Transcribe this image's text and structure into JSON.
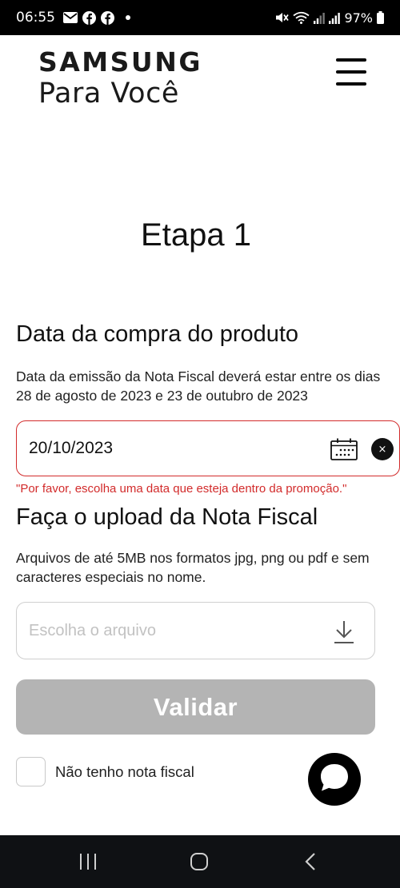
{
  "status_bar": {
    "time": "06:55",
    "battery": "97%",
    "icons": [
      "mail-icon",
      "facebook-icon",
      "facebook-icon",
      "dot-icon",
      "mute-icon",
      "wifi-icon",
      "signal-icon",
      "signal-icon",
      "battery-icon"
    ]
  },
  "header": {
    "brand": "SAMSUNG",
    "subtitle": "Para Você"
  },
  "step": {
    "title": "Etapa 1"
  },
  "purchase_date": {
    "title": "Data da compra do produto",
    "description": "Data da emissão da Nota Fiscal deverá estar entre os dias 28 de agosto de 2023 e 23 de outubro de 2023",
    "value": "20/10/2023",
    "clear_label": "×",
    "error": "\"Por favor, escolha uma data que esteja dentro da promoção.\""
  },
  "upload": {
    "title": "Faça o upload da Nota Fiscal",
    "description": "Arquivos de até 5MB nos formatos jpg, png ou pdf e sem caracteres especiais no nome.",
    "placeholder": "Escolha o arquivo"
  },
  "validate_label": "Validar",
  "no_invoice_label": "Não tenho nota fiscal",
  "colors": {
    "error": "#d22b2b",
    "button_disabled": "#b4b4b4",
    "nav_bar": "#0f1114"
  }
}
